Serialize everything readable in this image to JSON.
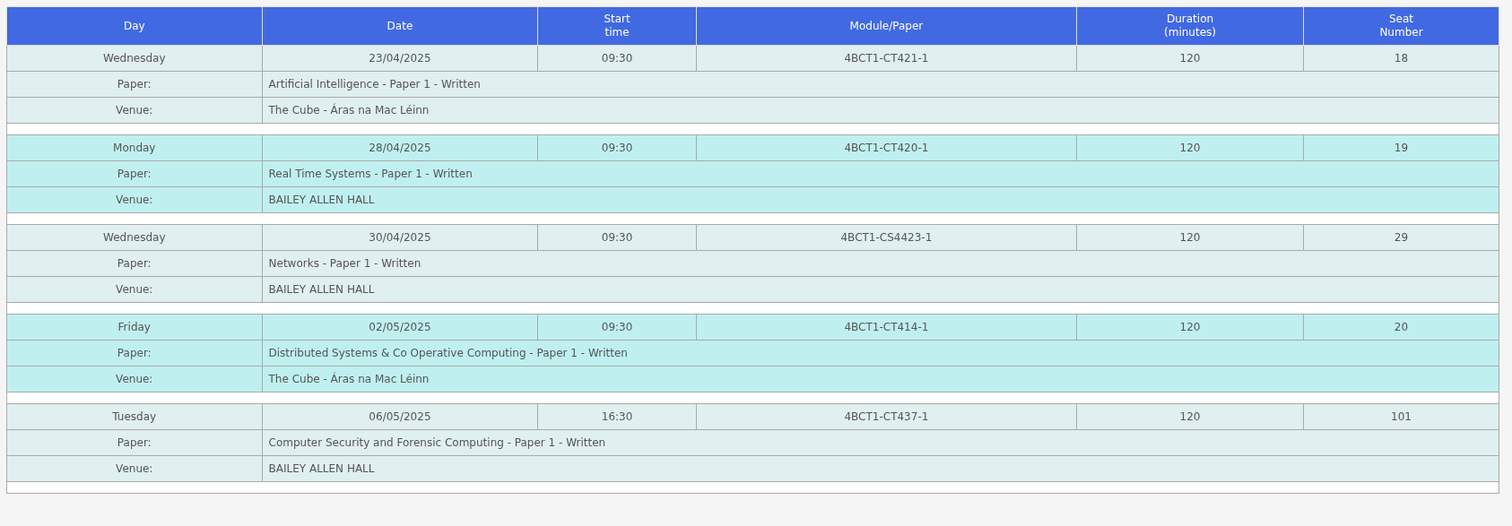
{
  "columns": [
    "Day",
    "Date",
    "Start\ntime",
    "Module/Paper",
    "Duration\n(minutes)",
    "Seat\nNumber"
  ],
  "exams": [
    {
      "day": "Wednesday",
      "date": "23/04/2025",
      "start_time": "09:30",
      "module": "4BCT1-CT421-1",
      "duration": "120",
      "seat": "18",
      "paper_label": "Paper:",
      "paper": "Artificial Intelligence - Paper 1 - Written",
      "venue_label": "Venue:",
      "venue": "The Cube - Áras na Mac Léinn"
    },
    {
      "day": "Monday",
      "date": "28/04/2025",
      "start_time": "09:30",
      "module": "4BCT1-CT420-1",
      "duration": "120",
      "seat": "19",
      "paper_label": "Paper:",
      "paper": "Real Time Systems - Paper 1 - Written",
      "venue_label": "Venue:",
      "venue": "BAILEY ALLEN HALL"
    },
    {
      "day": "Wednesday",
      "date": "30/04/2025",
      "start_time": "09:30",
      "module": "4BCT1-CS4423-1",
      "duration": "120",
      "seat": "29",
      "paper_label": "Paper:",
      "paper": "Networks - Paper 1 - Written",
      "venue_label": "Venue:",
      "venue": "BAILEY ALLEN HALL"
    },
    {
      "day": "Friday",
      "date": "02/05/2025",
      "start_time": "09:30",
      "module": "4BCT1-CT414-1",
      "duration": "120",
      "seat": "20",
      "paper_label": "Paper:",
      "paper": "Distributed Systems & Co Operative Computing - Paper 1 - Written",
      "venue_label": "Venue:",
      "venue": "The Cube - Áras na Mac Léinn"
    },
    {
      "day": "Tuesday",
      "date": "06/05/2025",
      "start_time": "16:30",
      "module": "4BCT1-CT437-1",
      "duration": "120",
      "seat": "101",
      "paper_label": "Paper:",
      "paper": "Computer Security and Forensic Computing - Paper 1 - Written",
      "venue_label": "Venue:",
      "venue": "BAILEY ALLEN HALL"
    }
  ]
}
